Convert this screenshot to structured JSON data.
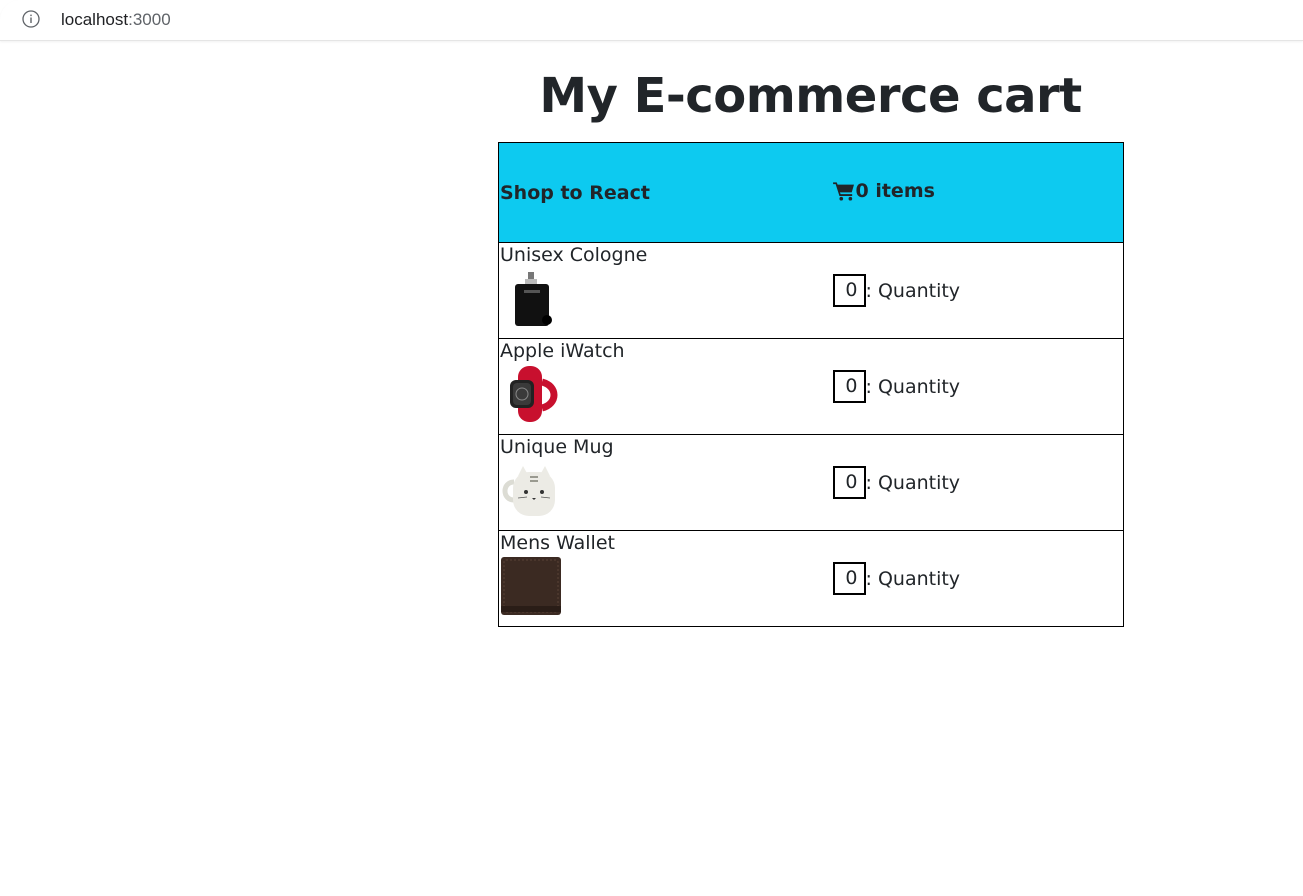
{
  "browser": {
    "url_host": "localhost",
    "url_port": ":3000"
  },
  "page": {
    "title": "My E-commerce cart"
  },
  "header": {
    "shop_name": "Shop to React",
    "cart_count": "0 items"
  },
  "items": [
    {
      "name": "Unisex Cologne",
      "quantity": "0",
      "quantity_label": ": Quantity"
    },
    {
      "name": "Apple iWatch",
      "quantity": "0",
      "quantity_label": ": Quantity"
    },
    {
      "name": "Unique Mug",
      "quantity": "0",
      "quantity_label": ": Quantity"
    },
    {
      "name": "Mens Wallet",
      "quantity": "0",
      "quantity_label": ": Quantity"
    }
  ],
  "colors": {
    "header_bg": "#0dcaf0",
    "text": "#212529",
    "border": "#000000"
  }
}
